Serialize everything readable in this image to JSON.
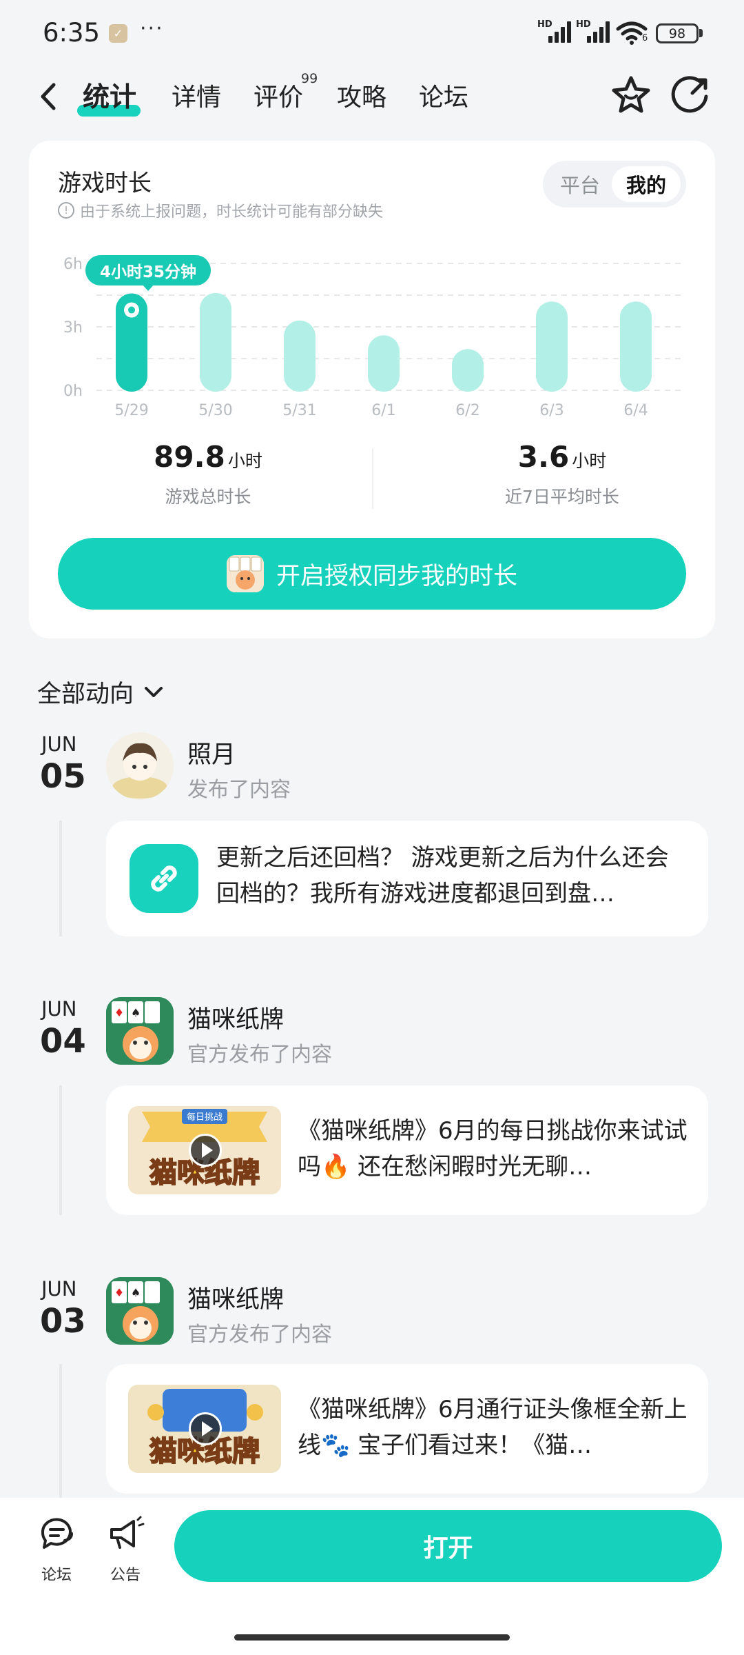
{
  "status_bar": {
    "time": "6:35",
    "more": "···",
    "hd1": "HD",
    "hd2": "HD",
    "wifi_sub": "6",
    "battery": "98"
  },
  "nav": {
    "tabs": [
      "统计",
      "详情",
      "评价",
      "攻略",
      "论坛"
    ],
    "active_tab": "统计",
    "review_badge": "99"
  },
  "stats": {
    "title": "游戏时长",
    "note": "由于系统上报问题，时长统计可能有部分缺失",
    "toggle": {
      "platform": "平台",
      "mine": "我的",
      "selected": "我的"
    },
    "tooltip": "4小时35分钟",
    "total": {
      "value": "89.8",
      "unit": "小时",
      "label": "游戏总时长"
    },
    "avg": {
      "value": "3.6",
      "unit": "小时",
      "label": "近7日平均时长"
    },
    "auth_button": "开启授权同步我的时长"
  },
  "chart_data": {
    "type": "bar",
    "categories": [
      "5/29",
      "5/30",
      "5/31",
      "6/1",
      "6/2",
      "6/3",
      "6/4"
    ],
    "values": [
      4.58,
      4.6,
      3.3,
      2.6,
      1.95,
      4.2,
      4.2
    ],
    "y_ticks": [
      "6h",
      "3h",
      "0h"
    ],
    "ylim": [
      0,
      6
    ],
    "highlighted_index": 0,
    "colors": {
      "highlight": "#18c9b3",
      "normal": "#b2efe6"
    },
    "grid": "dashed"
  },
  "feed": {
    "filter_label": "全部动向",
    "items": [
      {
        "month": "JUN",
        "day": "05",
        "author": "照月",
        "action": "发布了内容",
        "text": "更新之后还回档？ 游戏更新之后为什么还会回档的？我所有游戏进度都退回到盘…",
        "kind": "link"
      },
      {
        "month": "JUN",
        "day": "04",
        "author": "猫咪纸牌",
        "action": "官方发布了内容",
        "text": "《猫咪纸牌》6月的每日挑战你来试试吗🔥 还在愁闲暇时光无聊…",
        "kind": "video",
        "thumb_title": "猫咪纸牌",
        "thumb_ribbon": "每日挑战"
      },
      {
        "month": "JUN",
        "day": "03",
        "author": "猫咪纸牌",
        "action": "官方发布了内容",
        "text": "《猫咪纸牌》6月通行证头像框全新上线🐾 宝子们看过来！《猫…",
        "kind": "video",
        "thumb_title": "猫咪纸牌"
      }
    ]
  },
  "bottom_bar": {
    "forum": "论坛",
    "notice": "公告",
    "open": "打开"
  }
}
